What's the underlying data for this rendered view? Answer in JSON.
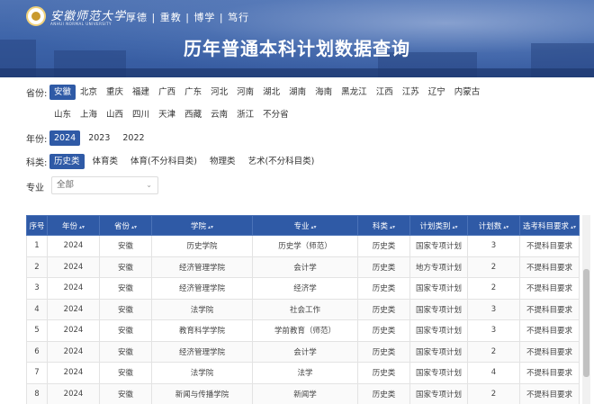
{
  "header": {
    "university_name": "安徽师范大学",
    "university_en": "ANHUI NORMAL UNIVERSITY",
    "motto": "厚德 | 重教 | 博学 | 笃行",
    "title": "历年普通本科计划数据查询"
  },
  "filters": {
    "province": {
      "label": "省份:",
      "row1": [
        "安徽",
        "北京",
        "重庆",
        "福建",
        "广西",
        "广东",
        "河北",
        "河南",
        "湖北",
        "湖南",
        "海南",
        "黑龙江",
        "江西",
        "江苏",
        "辽宁",
        "内蒙古"
      ],
      "row2": [
        "山东",
        "上海",
        "山西",
        "四川",
        "天津",
        "西藏",
        "云南",
        "浙江",
        "不分省"
      ],
      "selected": "安徽"
    },
    "year": {
      "label": "年份:",
      "options": [
        "2024",
        "2023",
        "2022"
      ],
      "selected": "2024"
    },
    "category": {
      "label": "科类:",
      "options": [
        "历史类",
        "体育类",
        "体育(不分科目类)",
        "物理类",
        "艺术(不分科目类)"
      ],
      "selected": "历史类"
    },
    "major": {
      "label": "专业",
      "value": "全部"
    }
  },
  "table": {
    "headers": [
      "序号",
      "年份",
      "省份",
      "学院",
      "专业",
      "科类",
      "计划类别",
      "计划数",
      "选考科目要求"
    ],
    "rows": [
      [
        "1",
        "2024",
        "安徽",
        "历史学院",
        "历史学（师范）",
        "历史类",
        "国家专项计划",
        "3",
        "不提科目要求"
      ],
      [
        "2",
        "2024",
        "安徽",
        "经济管理学院",
        "会计学",
        "历史类",
        "地方专项计划",
        "2",
        "不提科目要求"
      ],
      [
        "3",
        "2024",
        "安徽",
        "经济管理学院",
        "经济学",
        "历史类",
        "国家专项计划",
        "2",
        "不提科目要求"
      ],
      [
        "4",
        "2024",
        "安徽",
        "法学院",
        "社会工作",
        "历史类",
        "国家专项计划",
        "3",
        "不提科目要求"
      ],
      [
        "5",
        "2024",
        "安徽",
        "教育科学学院",
        "学前教育（师范）",
        "历史类",
        "国家专项计划",
        "3",
        "不提科目要求"
      ],
      [
        "6",
        "2024",
        "安徽",
        "经济管理学院",
        "会计学",
        "历史类",
        "国家专项计划",
        "2",
        "不提科目要求"
      ],
      [
        "7",
        "2024",
        "安徽",
        "法学院",
        "法学",
        "历史类",
        "国家专项计划",
        "4",
        "不提科目要求"
      ],
      [
        "8",
        "2024",
        "安徽",
        "新闻与传播学院",
        "新闻学",
        "历史类",
        "国家专项计划",
        "2",
        "不提科目要求"
      ]
    ]
  },
  "colors": {
    "accent": "#2f5aa6"
  },
  "icons": {
    "sort": "sort-icon",
    "dropdown": "chevron-down-icon",
    "logo": "university-seal-icon"
  }
}
